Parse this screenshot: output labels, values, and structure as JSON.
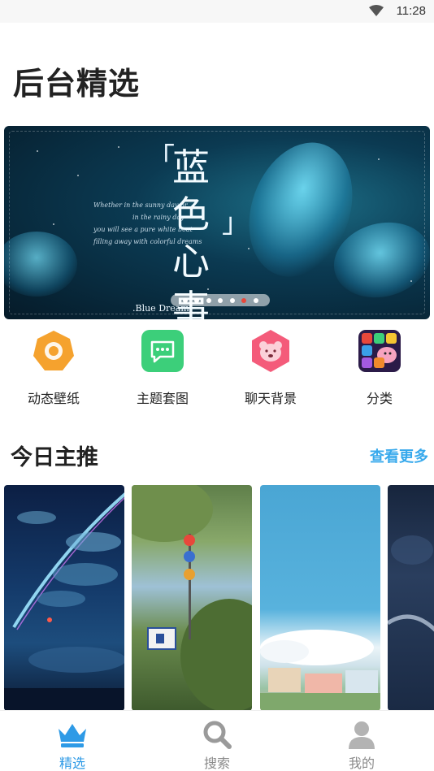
{
  "status_bar": {
    "time": "11:28"
  },
  "page": {
    "title": "后台精选"
  },
  "banner": {
    "calligraphy": "蓝色心事",
    "poem_lines": [
      "Whether in the sunny day or",
      "in the rainy day",
      "you will see a pure white boat",
      "filling away with colorful dreams"
    ],
    "brand": ".Blue Dream.",
    "page_count": 7,
    "active_index": 5
  },
  "quick_links": [
    {
      "label": "动态壁纸",
      "icon": "live-wallpaper-icon",
      "color": "#f5a22e"
    },
    {
      "label": "主题套图",
      "icon": "theme-message-icon",
      "color": "#3ccf7a"
    },
    {
      "label": "聊天背景",
      "icon": "chat-bear-icon",
      "color": "#f45b7a"
    },
    {
      "label": "分类",
      "icon": "category-grid-icon",
      "color": "#e8483b"
    }
  ],
  "recommend": {
    "title": "今日主推",
    "more_label": "查看更多",
    "accent": "#37a9ec"
  },
  "tabbar": {
    "items": [
      {
        "label": "精选",
        "icon": "crown-icon",
        "active": true
      },
      {
        "label": "搜索",
        "icon": "search-icon",
        "active": false
      },
      {
        "label": "我的",
        "icon": "user-icon",
        "active": false
      }
    ],
    "active_color": "#2e9ae6",
    "inactive_color": "#9a9a9a"
  }
}
